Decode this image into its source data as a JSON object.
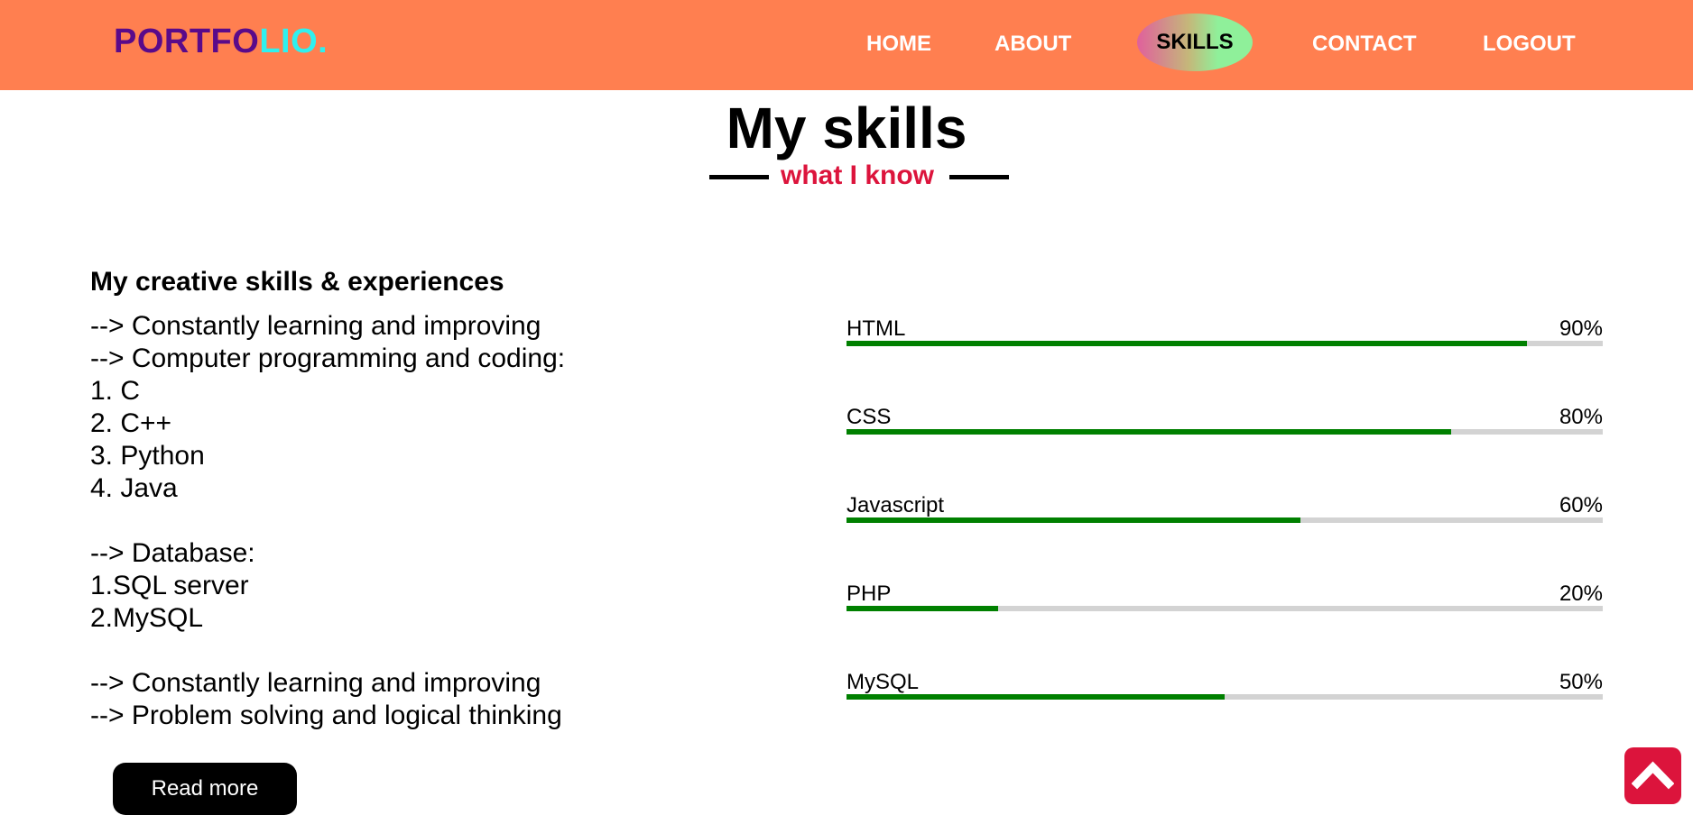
{
  "logo": {
    "part1": "PORTFO",
    "part2": "LIO."
  },
  "nav": {
    "items": [
      {
        "label": "HOME"
      },
      {
        "label": "ABOUT"
      },
      {
        "label": "SKILLS",
        "active": true
      },
      {
        "label": "CONTACT"
      },
      {
        "label": "LOGOUT"
      }
    ]
  },
  "heading": {
    "title": "My skills",
    "subtitle": "what I know"
  },
  "intro": {
    "heading": "My creative skills & experiences",
    "lines": [
      "--> Constantly learning and improving",
      "--> Computer programming and coding:",
      "1. C",
      "2. C++",
      "3. Python",
      "4. Java",
      "",
      "--> Database:",
      "1.SQL server",
      "2.MySQL",
      "",
      "--> Constantly learning and improving",
      "--> Problem solving and logical thinking"
    ],
    "button": "Read more"
  },
  "skills": [
    {
      "name": "HTML",
      "percent_label": "90%",
      "value": 90
    },
    {
      "name": "CSS",
      "percent_label": "80%",
      "value": 80
    },
    {
      "name": "Javascript",
      "percent_label": "60%",
      "value": 60
    },
    {
      "name": "PHP",
      "percent_label": "20%",
      "value": 20
    },
    {
      "name": "MySQL",
      "percent_label": "50%",
      "value": 50
    }
  ],
  "colors": {
    "navbar": "#ff7f50",
    "logo_part1": "#5a0a8a",
    "logo_part2": "#2ff0ee",
    "subtitle": "#dc143c",
    "bar_fill": "#008000",
    "bar_track": "#d3d3d3",
    "scroll_button": "#dc143c"
  },
  "icons": {
    "scroll_top": "chevron-up-icon"
  }
}
